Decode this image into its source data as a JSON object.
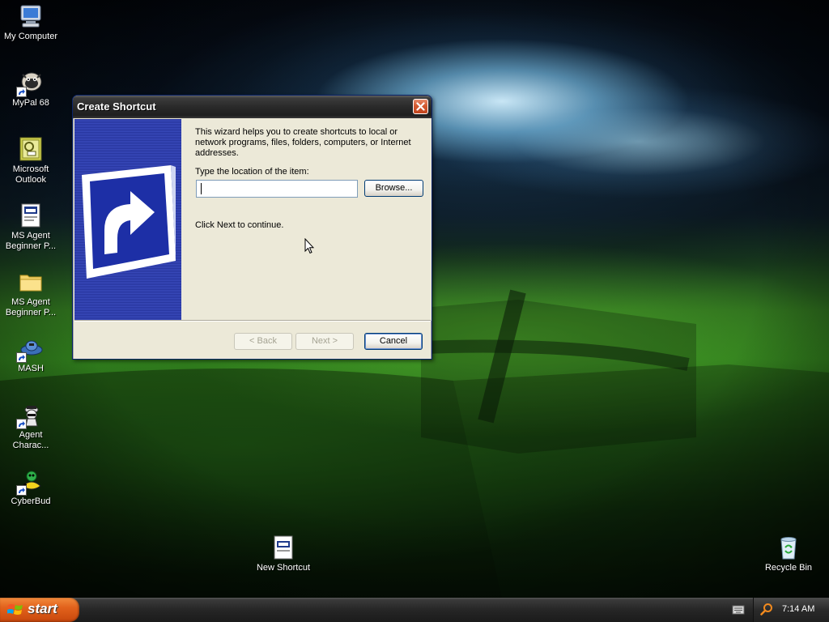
{
  "desktop": {
    "icons": [
      {
        "label": "My Computer",
        "icon": "my-computer-icon"
      },
      {
        "label": "MyPal 68",
        "icon": "mypal-browser-icon"
      },
      {
        "label": "Microsoft Outlook",
        "icon": "outlook-icon"
      },
      {
        "label": "MS Agent Beginner P...",
        "icon": "document-icon"
      },
      {
        "label": "MS Agent Beginner P...",
        "icon": "folder-icon"
      },
      {
        "label": "MASH",
        "icon": "mash-icon"
      },
      {
        "label": "Agent Charac...",
        "icon": "agent-character-icon"
      },
      {
        "label": "CyberBud",
        "icon": "cyberbud-icon"
      },
      {
        "label": "New Shortcut",
        "icon": "new-shortcut-icon"
      },
      {
        "label": "Recycle Bin",
        "icon": "recycle-bin-icon"
      }
    ]
  },
  "dialog": {
    "title": "Create Shortcut",
    "intro": "This wizard helps you to create shortcuts to local or network programs, files, folders, computers, or Internet addresses.",
    "location_label": "Type the location of the item:",
    "location_value": "",
    "browse_label": "Browse...",
    "continue_hint": "Click Next to continue.",
    "back_label": "< Back",
    "next_label": "Next >",
    "cancel_label": "Cancel"
  },
  "taskbar": {
    "start_label": "start",
    "clock": "7:14 AM"
  },
  "colors": {
    "start_orange": "#e2621c",
    "banner_blue": "#2f3fae",
    "dialog_bg": "#ece9d8"
  }
}
